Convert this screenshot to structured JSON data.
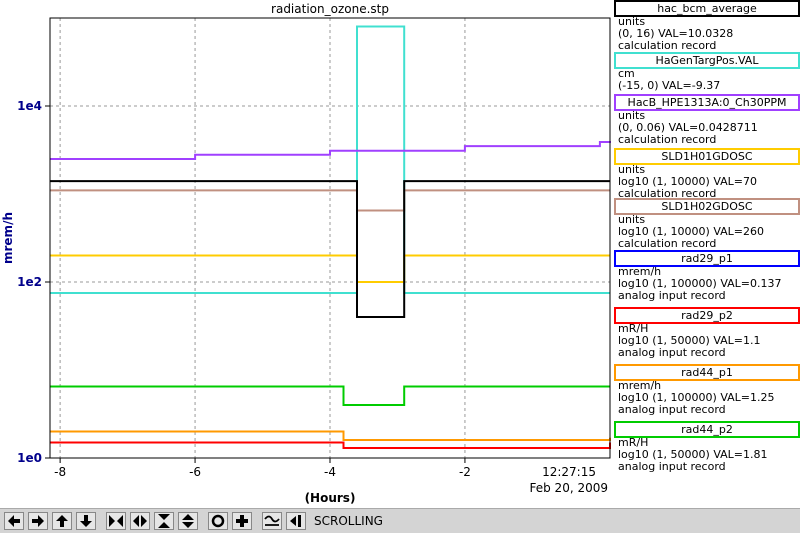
{
  "window": {
    "title": "radiation_ozone.stp"
  },
  "chart_data": {
    "type": "line",
    "title": "radiation_ozone.stp",
    "xlabel": "(Hours)",
    "ylabel": "mrem/h",
    "xlim": [
      -8.15,
      0.15
    ],
    "ylim": [
      1,
      100000
    ],
    "yscale": "log",
    "x_ticks": [
      -8,
      -6,
      -4,
      -2
    ],
    "x_tick_labels": [
      "-8",
      "-6",
      "-4",
      "-2"
    ],
    "y_ticks": [
      1,
      100,
      10000
    ],
    "y_tick_labels": [
      "1e0",
      "1e2",
      "1e4"
    ],
    "grid": true,
    "end_time": "12:27:15",
    "end_date": "Feb 20, 2009",
    "series": [
      {
        "name": "HaGenTargPos.VAL",
        "color": "#40e0d0",
        "x": [
          -8.15,
          -3.6,
          -3.6,
          -2.9,
          -2.9,
          0.15
        ],
        "y": [
          75,
          75,
          80000,
          80000,
          75,
          75
        ]
      },
      {
        "name": "HacB_HPE1313A:0_Ch30PPM",
        "color": "#a040ff",
        "x": [
          -8.15,
          -6,
          -4,
          -2,
          0,
          0.15
        ],
        "y": [
          2500,
          2800,
          3100,
          3500,
          3900,
          4000
        ]
      },
      {
        "name": "SLD1H01GDOSC",
        "color": "#ffcc00",
        "x": [
          -8.15,
          -3.6,
          -3.6,
          -2.9,
          -2.9,
          0.15
        ],
        "y": [
          200,
          200,
          100,
          100,
          200,
          200
        ]
      },
      {
        "name": "SLD1H02GDOSC",
        "color": "#c09080",
        "x": [
          -8.15,
          -3.6,
          -3.6,
          -2.9,
          -2.9,
          0.15
        ],
        "y": [
          1100,
          1100,
          650,
          650,
          1100,
          1100
        ]
      },
      {
        "name": "rad29_p1",
        "color": "#000000",
        "x": [
          -8.15,
          -3.6,
          -3.6,
          -2.9,
          -2.9,
          0.15
        ],
        "y": [
          1400,
          1400,
          40,
          40,
          1400,
          1400
        ]
      },
      {
        "name": "rad29_p2",
        "color": "#ff0000",
        "x": [
          -8.15,
          -3.8,
          -3.8,
          0.15
        ],
        "y": [
          1.5,
          1.5,
          1.3,
          1.5
        ]
      },
      {
        "name": "rad44_p1",
        "color": "#ff9900",
        "x": [
          -8.15,
          -3.8,
          -3.8,
          0.15
        ],
        "y": [
          2.0,
          2.0,
          1.6,
          1.7
        ]
      },
      {
        "name": "rad44_p2",
        "color": "#00cc00",
        "x": [
          -8.15,
          -3.8,
          -3.8,
          -2.9,
          0.15
        ],
        "y": [
          6.5,
          6.5,
          4.0,
          6.5,
          6.5
        ]
      }
    ]
  },
  "legend": [
    {
      "name": "hac_bcm_average",
      "color": "#000000",
      "units": "units",
      "range": "(0, 16) VAL=10.0328",
      "record": "calculation record"
    },
    {
      "name": "HaGenTargPos.VAL",
      "color": "#40e0d0",
      "units": "cm",
      "range": "(-15, 0) VAL=-9.37",
      "record": ""
    },
    {
      "name": "HacB_HPE1313A:0_Ch30PPM",
      "color": "#a040ff",
      "units": "units",
      "range": "(0, 0.06) VAL=0.0428711",
      "record": "calculation record"
    },
    {
      "name": "SLD1H01GDOSC",
      "color": "#ffcc00",
      "units": "units",
      "range": "log10 (1, 10000) VAL=70",
      "record": "calculation record"
    },
    {
      "name": "SLD1H02GDOSC",
      "color": "#c09080",
      "units": "units",
      "range": "log10 (1, 10000) VAL=260",
      "record": "calculation record"
    },
    {
      "name": "rad29_p1",
      "color": "#0000ff",
      "units": "mrem/h",
      "range": "log10 (1, 100000) VAL=0.137",
      "record": "analog input record"
    },
    {
      "name": "rad29_p2",
      "color": "#ff0000",
      "units": "mR/H",
      "range": "log10 (1, 50000) VAL=1.1",
      "record": "analog input record"
    },
    {
      "name": "rad44_p1",
      "color": "#ff9900",
      "units": "mrem/h",
      "range": "log10 (1, 100000) VAL=1.25",
      "record": "analog input record"
    },
    {
      "name": "rad44_p2",
      "color": "#00cc00",
      "units": "mR/H",
      "range": "log10 (1, 50000) VAL=1.81",
      "record": "analog input record"
    }
  ],
  "toolbar": {
    "status": "SCROLLING",
    "buttons": [
      {
        "icon": "arrow-left-icon"
      },
      {
        "icon": "arrow-right-icon"
      },
      {
        "icon": "arrow-up-icon"
      },
      {
        "icon": "arrow-down-icon"
      },
      {
        "icon": "zoom-in-horizontal-icon"
      },
      {
        "icon": "zoom-out-horizontal-icon"
      },
      {
        "icon": "zoom-in-vertical-icon"
      },
      {
        "icon": "zoom-out-vertical-icon"
      },
      {
        "icon": "zoom-full-icon"
      },
      {
        "icon": "zoom-plus-icon"
      },
      {
        "icon": "autoscale-icon"
      },
      {
        "icon": "scroll-mode-icon"
      }
    ]
  }
}
